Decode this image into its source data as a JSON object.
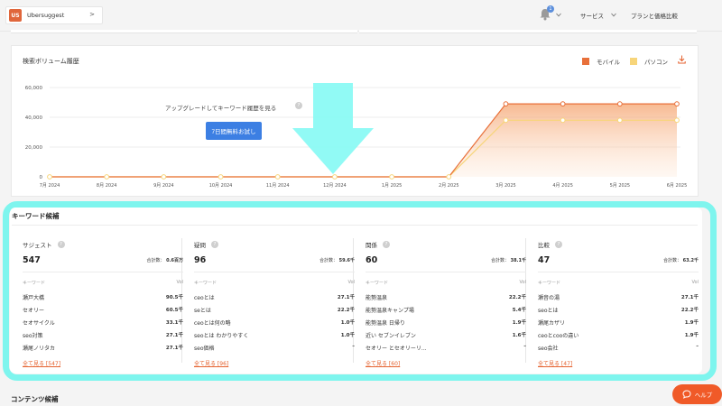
{
  "header": {
    "project_badge": "US",
    "project_name": "Ubersuggest",
    "project_chevron": ">",
    "notification_count": "1",
    "nav": [
      {
        "label": "サービス"
      },
      {
        "label": "プランと価格比較"
      }
    ]
  },
  "volume_card": {
    "title": "検索ボリューム履歴",
    "legend": [
      {
        "label": "モバイル",
        "color": "#e8703a"
      },
      {
        "label": "パソコン",
        "color": "#f7d57a"
      }
    ],
    "upgrade_text": "アップグレードしてキーワード履歴を見る",
    "help_glyph": "?",
    "trial_button": "7日間無料お試し"
  },
  "chart_data": {
    "type": "line",
    "x": [
      "7月 2024",
      "8月 2024",
      "9月 2024",
      "10月 2024",
      "11月 2024",
      "12月 2024",
      "1月 2025",
      "2月 2025",
      "3月 2025",
      "4月 2025",
      "5月 2025",
      "6月 2025"
    ],
    "y_ticks": [
      "0",
      "20,000",
      "40,000",
      "60,000"
    ],
    "ylim": [
      0,
      60000
    ],
    "series": [
      {
        "name": "モバイル",
        "color": "#e8703a",
        "values": [
          0,
          0,
          0,
          0,
          0,
          0,
          0,
          0,
          49000,
          49000,
          49000,
          49000
        ]
      },
      {
        "name": "パソコン",
        "color": "#f7d57a",
        "values": [
          0,
          0,
          0,
          0,
          0,
          0,
          0,
          0,
          38000,
          38000,
          38000,
          38000
        ]
      }
    ],
    "grid": true,
    "legend": "top-right"
  },
  "keywords": {
    "title": "キーワード候補",
    "total_label": "合計数：",
    "col_keyword": "キーワード",
    "col_vol": "Vol",
    "columns": [
      {
        "name": "サジェスト",
        "count": "547",
        "total": "0.6百万",
        "rows": [
          {
            "kw": "瀬戸大橋",
            "vol": "90.5千"
          },
          {
            "kw": "セオリー",
            "vol": "60.5千"
          },
          {
            "kw": "セオサイクル",
            "vol": "33.1千"
          },
          {
            "kw": "seo対策",
            "vol": "27.1千"
          },
          {
            "kw": "瀬尾ノリタカ",
            "vol": "27.1千"
          }
        ],
        "see_all": "全て見る [547]"
      },
      {
        "name": "疑問",
        "count": "96",
        "total": "59.6千",
        "rows": [
          {
            "kw": "ceoとは",
            "vol": "27.1千"
          },
          {
            "kw": "seとは",
            "vol": "22.2千"
          },
          {
            "kw": "ceoとは何の略",
            "vol": "1.0千"
          },
          {
            "kw": "seoとは わかりやすく",
            "vol": "1.0千"
          },
          {
            "kw": "seo価格",
            "vol": "–"
          }
        ],
        "see_all": "全て見る [96]"
      },
      {
        "name": "関係",
        "count": "60",
        "total": "38.1千",
        "rows": [
          {
            "kw": "能勢温泉",
            "vol": "22.2千"
          },
          {
            "kw": "能勢温泉キャンプ場",
            "vol": "5.4千"
          },
          {
            "kw": "能勢温泉 日帰り",
            "vol": "1.9千"
          },
          {
            "kw": "近い セブンイレブン",
            "vol": "1.6千"
          },
          {
            "kw": "セオリー とセオリーリ...",
            "vol": "–"
          }
        ],
        "see_all": "全て見る [60]"
      },
      {
        "name": "比較",
        "count": "47",
        "total": "63.2千",
        "rows": [
          {
            "kw": "瀬音の湯",
            "vol": "27.1千"
          },
          {
            "kw": "seoとは",
            "vol": "22.2千"
          },
          {
            "kw": "瀬尾カザリ",
            "vol": "1.9千"
          },
          {
            "kw": "ceoとcooの違い",
            "vol": "1.9千"
          },
          {
            "kw": "seo会社",
            "vol": "–"
          }
        ],
        "see_all": "全て見る [47]"
      }
    ]
  },
  "content_title": "コンテンツ候補",
  "help_button": "ヘルプ",
  "colors": {
    "accent_orange": "#f05a28",
    "highlight_cyan": "#7ef5ee",
    "arrow_cyan": "#8bfaf4",
    "button_blue": "#3c7fe3"
  }
}
